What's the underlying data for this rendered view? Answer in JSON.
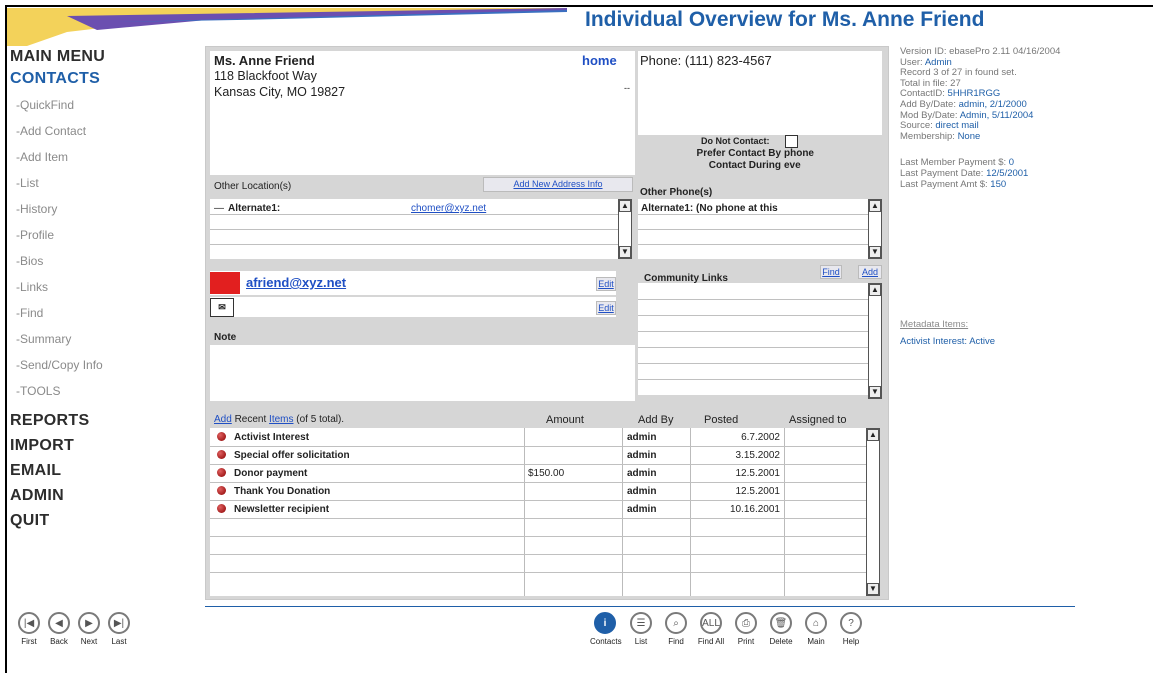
{
  "page_title": "Individual Overview for Ms. Anne Friend",
  "nav": {
    "main_menu": "MAIN MENU",
    "contacts": "CONTACTS",
    "sub_items": [
      "-QuickFind",
      "-Add Contact",
      "-Add Item",
      "-List",
      "-History",
      "-Profile",
      "-Bios",
      "-Links",
      "-Find",
      "-Summary",
      "-Send/Copy Info",
      "-TOOLS"
    ],
    "bottom_items": [
      "REPORTS",
      "IMPORT",
      "EMAIL",
      "ADMIN",
      "QUIT"
    ]
  },
  "contact": {
    "name": "Ms. Anne Friend",
    "address1": "118 Blackfoot Way",
    "address2": "Kansas City, MO 19827",
    "home_label": "home",
    "phone": "Phone: (111) 823-4567",
    "dash": "--",
    "do_not_contact_label": "Do Not Contact:",
    "prefer_label": "Prefer Contact By",
    "prefer_value": "phone",
    "during_label": "Contact During",
    "during_value": "eve"
  },
  "other_locations": {
    "header": "Other Location(s)",
    "add_btn": "Add New Address Info",
    "row_label": "Alternate1:",
    "row_email": "chomer@xyz.net"
  },
  "other_phones": {
    "header": "Other Phone(s)",
    "row": "Alternate1: (No phone at this"
  },
  "email": {
    "address": "afriend@xyz.net",
    "edit1": "Edit",
    "edit2": "Edit",
    "note_label": "Note"
  },
  "community": {
    "header": "Community Links",
    "find": "Find",
    "add": "Add"
  },
  "items": {
    "add_link": "Add",
    "recent_prefix": "Recent",
    "items_link": "Items",
    "recent_suffix": "(of 5 total).",
    "headers": {
      "amount": "Amount",
      "add_by": "Add By",
      "posted": "Posted",
      "assigned": "Assigned to"
    },
    "rows": [
      {
        "name": "Activist Interest",
        "amount": "",
        "add_by": "admin",
        "posted": "6.7.2002"
      },
      {
        "name": "Special offer solicitation",
        "amount": "",
        "add_by": "admin",
        "posted": "3.15.2002"
      },
      {
        "name": "Donor payment",
        "amount": "$150.00",
        "add_by": "admin",
        "posted": "12.5.2001"
      },
      {
        "name": "Thank You Donation",
        "amount": "",
        "add_by": "admin",
        "posted": "12.5.2001"
      },
      {
        "name": "Newsletter recipient",
        "amount": "",
        "add_by": "admin",
        "posted": "10.16.2001"
      }
    ]
  },
  "info": {
    "version": "Version ID: ebasePro 2.11 04/16/2004",
    "user_k": "User:",
    "user_v": "Admin",
    "record": "Record 3 of 27 in found set.",
    "total": "Total in file: 27",
    "contactid_k": "ContactID:",
    "contactid_v": "5HHR1RGG",
    "addby_k": "Add By/Date:",
    "addby_v": "admin, 2/1/2000",
    "modby_k": "Mod By/Date:",
    "modby_v": "Admin, 5/11/2004",
    "source_k": "Source:",
    "source_v": "direct mail",
    "membership_k": "Membership:",
    "membership_v": "None",
    "last_member_k": "Last Member Payment $:",
    "last_member_v": "0",
    "last_date_k": "Last Payment Date:",
    "last_date_v": "12/5/2001",
    "last_amt_k": "Last Payment Amt $:",
    "last_amt_v": "150",
    "metadata_link": "Metadata Items:",
    "meta_k": "Activist Interest:",
    "meta_v": "Active"
  },
  "toolbar_left": [
    "First",
    "Back",
    "Next",
    "Last"
  ],
  "toolbar_right": [
    "Contacts",
    "List",
    "Find",
    "Find All",
    "Print",
    "Delete",
    "Main",
    "Help"
  ]
}
